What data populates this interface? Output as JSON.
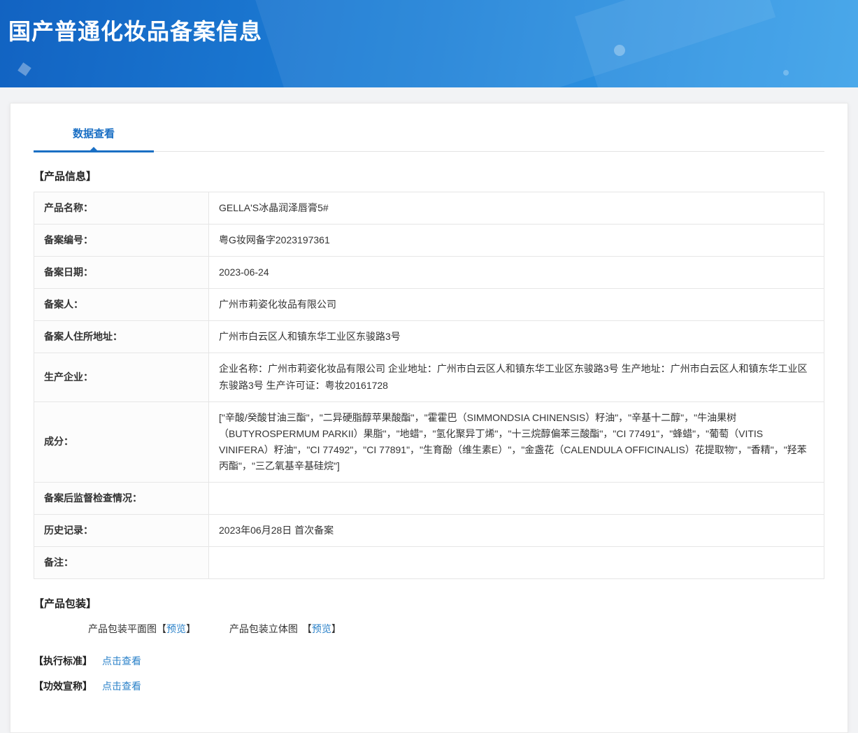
{
  "colors": {
    "banner_blue": "#1e7fd6",
    "accent": "#1a6fc4",
    "link": "#2b82c9"
  },
  "header": {
    "title": "国产普通化妆品备案信息"
  },
  "tabs": {
    "data_view": "数据查看"
  },
  "product_info": {
    "section_title": "【产品信息】",
    "rows": [
      {
        "label": "产品名称：",
        "value": "GELLA'S冰晶润泽唇膏5#"
      },
      {
        "label": "备案编号：",
        "value": "粤G妆网备字2023197361"
      },
      {
        "label": "备案日期：",
        "value": "2023-06-24"
      },
      {
        "label": "备案人：",
        "value": "广州市莉姿化妆品有限公司"
      },
      {
        "label": "备案人住所地址：",
        "value": "广州市白云区人和镇东华工业区东骏路3号"
      },
      {
        "label": "生产企业：",
        "value": "企业名称：广州市莉姿化妆品有限公司 企业地址：广州市白云区人和镇东华工业区东骏路3号 生产地址：广州市白云区人和镇东华工业区东骏路3号 生产许可证：粤妆20161728"
      },
      {
        "label": "成分：",
        "value": "[\"辛酸/癸酸甘油三酯\"，\"二异硬脂醇苹果酸酯\"，\"霍霍巴（SIMMONDSIA CHINENSIS）籽油\"，\"辛基十二醇\"，\"牛油果树（BUTYROSPERMUM PARKII）果脂\"，\"地蜡\"，\"氢化聚异丁烯\"，\"十三烷醇偏苯三酸酯\"，\"CI 77491\"，\"蜂蜡\"，\"葡萄（VITIS VINIFERA）籽油\"，\"CI 77492\"，\"CI 77891\"，\"生育酚（维生素E）\"，\"金盏花（CALENDULA OFFICINALIS）花提取物\"，\"香精\"，\"羟苯丙酯\"，\"三乙氧基辛基硅烷\"]"
      },
      {
        "label": "备案后监督检查情况：",
        "value": ""
      },
      {
        "label": "历史记录：",
        "value": "2023年06月28日 首次备案"
      },
      {
        "label": "备注：",
        "value": ""
      }
    ]
  },
  "packaging": {
    "section_title": "【产品包装】",
    "bracket_open": "【",
    "bracket_close": "】",
    "items": [
      {
        "label": "产品包装平面图",
        "link": "预览"
      },
      {
        "label": "产品包装立体图",
        "link": "预览"
      }
    ]
  },
  "standards": {
    "label": "【执行标准】",
    "link": "点击查看"
  },
  "efficacy": {
    "label": "【功效宣称】",
    "link": "点击查看"
  }
}
